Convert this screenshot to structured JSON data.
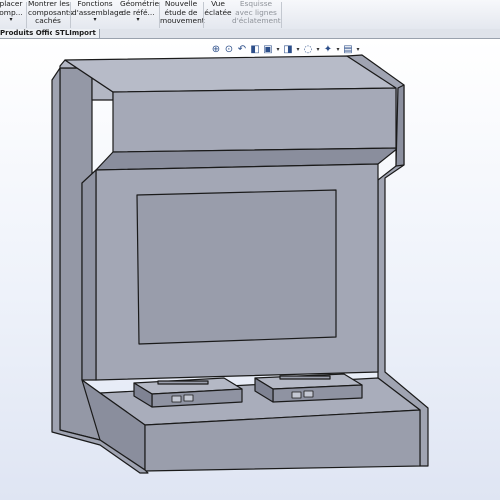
{
  "ribbon": {
    "buttons": [
      {
        "lines": [
          "placer",
          "omp..."
        ],
        "arrow": "▾",
        "disabled": false
      },
      {
        "lines": [
          "Montrer les",
          "composants",
          "cachés"
        ],
        "arrow": "",
        "disabled": false
      },
      {
        "lines": [
          "Fonctions",
          "d'assemblage"
        ],
        "arrow": "▾",
        "disabled": false
      },
      {
        "lines": [
          "Géométrie",
          "de réfé..."
        ],
        "arrow": "▾",
        "disabled": false
      },
      {
        "lines": [
          "Nouvelle",
          "étude de",
          "mouvement"
        ],
        "arrow": "",
        "disabled": false
      },
      {
        "lines": [
          "Vue",
          "éclatée"
        ],
        "arrow": "",
        "disabled": false
      },
      {
        "lines": [
          "Esquisse",
          "avec lignes",
          "d'éclatement"
        ],
        "arrow": "",
        "disabled": true
      }
    ]
  },
  "tabs": [
    "Produits Office",
    "STLImport"
  ],
  "view_toolbar": {
    "icons": [
      "zoom-to-fit-icon",
      "zoom-area-icon",
      "previous-view-icon",
      "section-view-icon",
      "view-orientation-icon",
      "display-style-icon",
      "hide-show-items-icon",
      "edit-appearance-icon",
      "apply-scene-icon",
      "view-settings-icon"
    ]
  },
  "colors": {
    "part_face_light": "#a8acba",
    "part_face_mid": "#9599a8",
    "part_face_dark": "#7d8191",
    "screen": "#9a9eac",
    "edge": "#1a1a1a",
    "viewport_top": "#ffffff",
    "viewport_bottom": "#dfe5f3"
  }
}
